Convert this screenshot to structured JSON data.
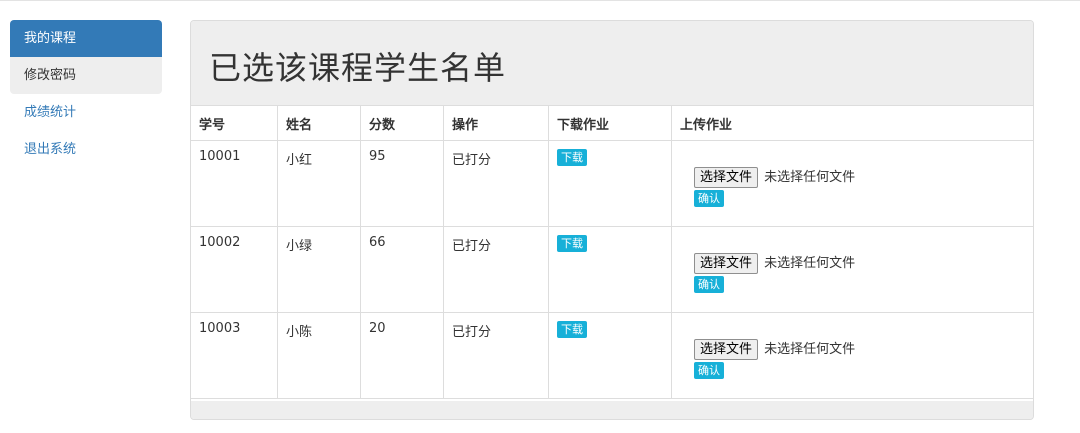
{
  "sidebar": {
    "items": [
      {
        "label": "我的课程"
      },
      {
        "label": "修改密码"
      },
      {
        "label": "成绩统计"
      },
      {
        "label": "退出系统"
      }
    ]
  },
  "panel": {
    "title": "已选该课程学生名单"
  },
  "table": {
    "headers": [
      "学号",
      "姓名",
      "分数",
      "操作",
      "下载作业",
      "上传作业"
    ],
    "rows": [
      {
        "id": "10001",
        "name": "小红",
        "score": "95",
        "status": "已打分",
        "download": "下载",
        "file_button": "选择文件",
        "file_status": "未选择任何文件",
        "confirm": "确认"
      },
      {
        "id": "10002",
        "name": "小绿",
        "score": "66",
        "status": "已打分",
        "download": "下载",
        "file_button": "选择文件",
        "file_status": "未选择任何文件",
        "confirm": "确认"
      },
      {
        "id": "10003",
        "name": "小陈",
        "score": "20",
        "status": "已打分",
        "download": "下载",
        "file_button": "选择文件",
        "file_status": "未选择任何文件",
        "confirm": "确认"
      }
    ]
  },
  "colors": {
    "accent": "#337ab7",
    "button": "#17b0d8",
    "panel_head": "#eeeeee"
  }
}
